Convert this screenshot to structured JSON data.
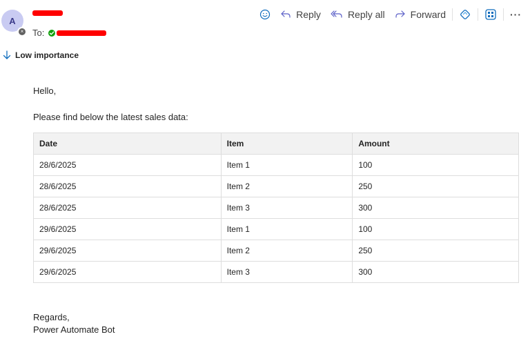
{
  "sender": {
    "avatar_initial": "A"
  },
  "recipients": {
    "to_label": "To:"
  },
  "toolbar": {
    "reply_label": "Reply",
    "reply_all_label": "Reply all",
    "forward_label": "Forward",
    "more_label": "···"
  },
  "importance": {
    "label": "Low importance",
    "color": "#0f6cbd"
  },
  "message": {
    "greeting": "Hello,",
    "intro": "Please find below the latest sales data:",
    "table": {
      "headers": [
        "Date",
        "Item",
        "Amount"
      ],
      "rows": [
        [
          "28/6/2025",
          "Item 1",
          "100"
        ],
        [
          "28/6/2025",
          "Item 2",
          "250"
        ],
        [
          "28/6/2025",
          "Item 3",
          "300"
        ],
        [
          "29/6/2025",
          "Item 1",
          "100"
        ],
        [
          "29/6/2025",
          "Item 2",
          "250"
        ],
        [
          "29/6/2025",
          "Item 3",
          "300"
        ]
      ]
    },
    "closing": "Regards,",
    "signature": "Power Automate Bot"
  },
  "colors": {
    "redaction": "#ff0000",
    "accent": "#0f6cbd",
    "avatar_bg": "#c9cbf2",
    "presence_ok": "#13a10e"
  }
}
